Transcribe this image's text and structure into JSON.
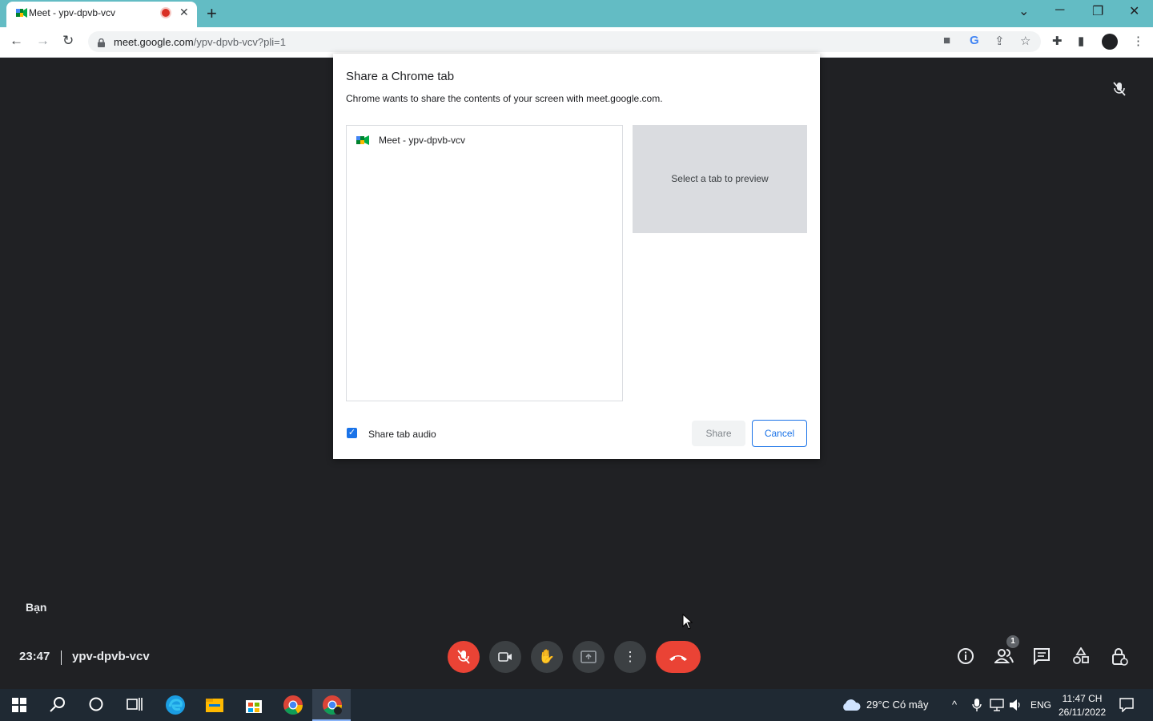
{
  "browser": {
    "tab_title": "Meet - ypv-dpvb-vcv",
    "tab_close": "✕",
    "new_tab": "+",
    "url_host": "meet.google.com",
    "url_path": "/ypv-dpvb-vcv?pli=1",
    "back": "←",
    "forward": "→",
    "reload": "↻",
    "win_dropdown": "⌄",
    "win_minimize": "─",
    "win_restore": "❐",
    "win_close": "✕"
  },
  "dialog": {
    "title": "Share a Chrome tab",
    "subtitle": "Chrome wants to share the contents of your screen with meet.google.com.",
    "tab_item": "Meet - ypv-dpvb-vcv",
    "preview_text": "Select a tab to preview",
    "audio_label": "Share tab audio",
    "audio_checked": "✓",
    "share_button": "Share",
    "cancel_button": "Cancel"
  },
  "meet": {
    "self_label": "Bạn",
    "time": "23:47",
    "meeting_code": "ypv-dpvb-vcv",
    "participants_count": "1"
  },
  "taskbar": {
    "weather": "29°C  Có mây",
    "language": "ENG",
    "time": "11:47 CH",
    "date": "26/11/2022"
  },
  "colors": {
    "tab_strip": "#63bcc4",
    "meet_background": "#202124",
    "end_call": "#ea4335",
    "accent": "#1a73e8"
  }
}
